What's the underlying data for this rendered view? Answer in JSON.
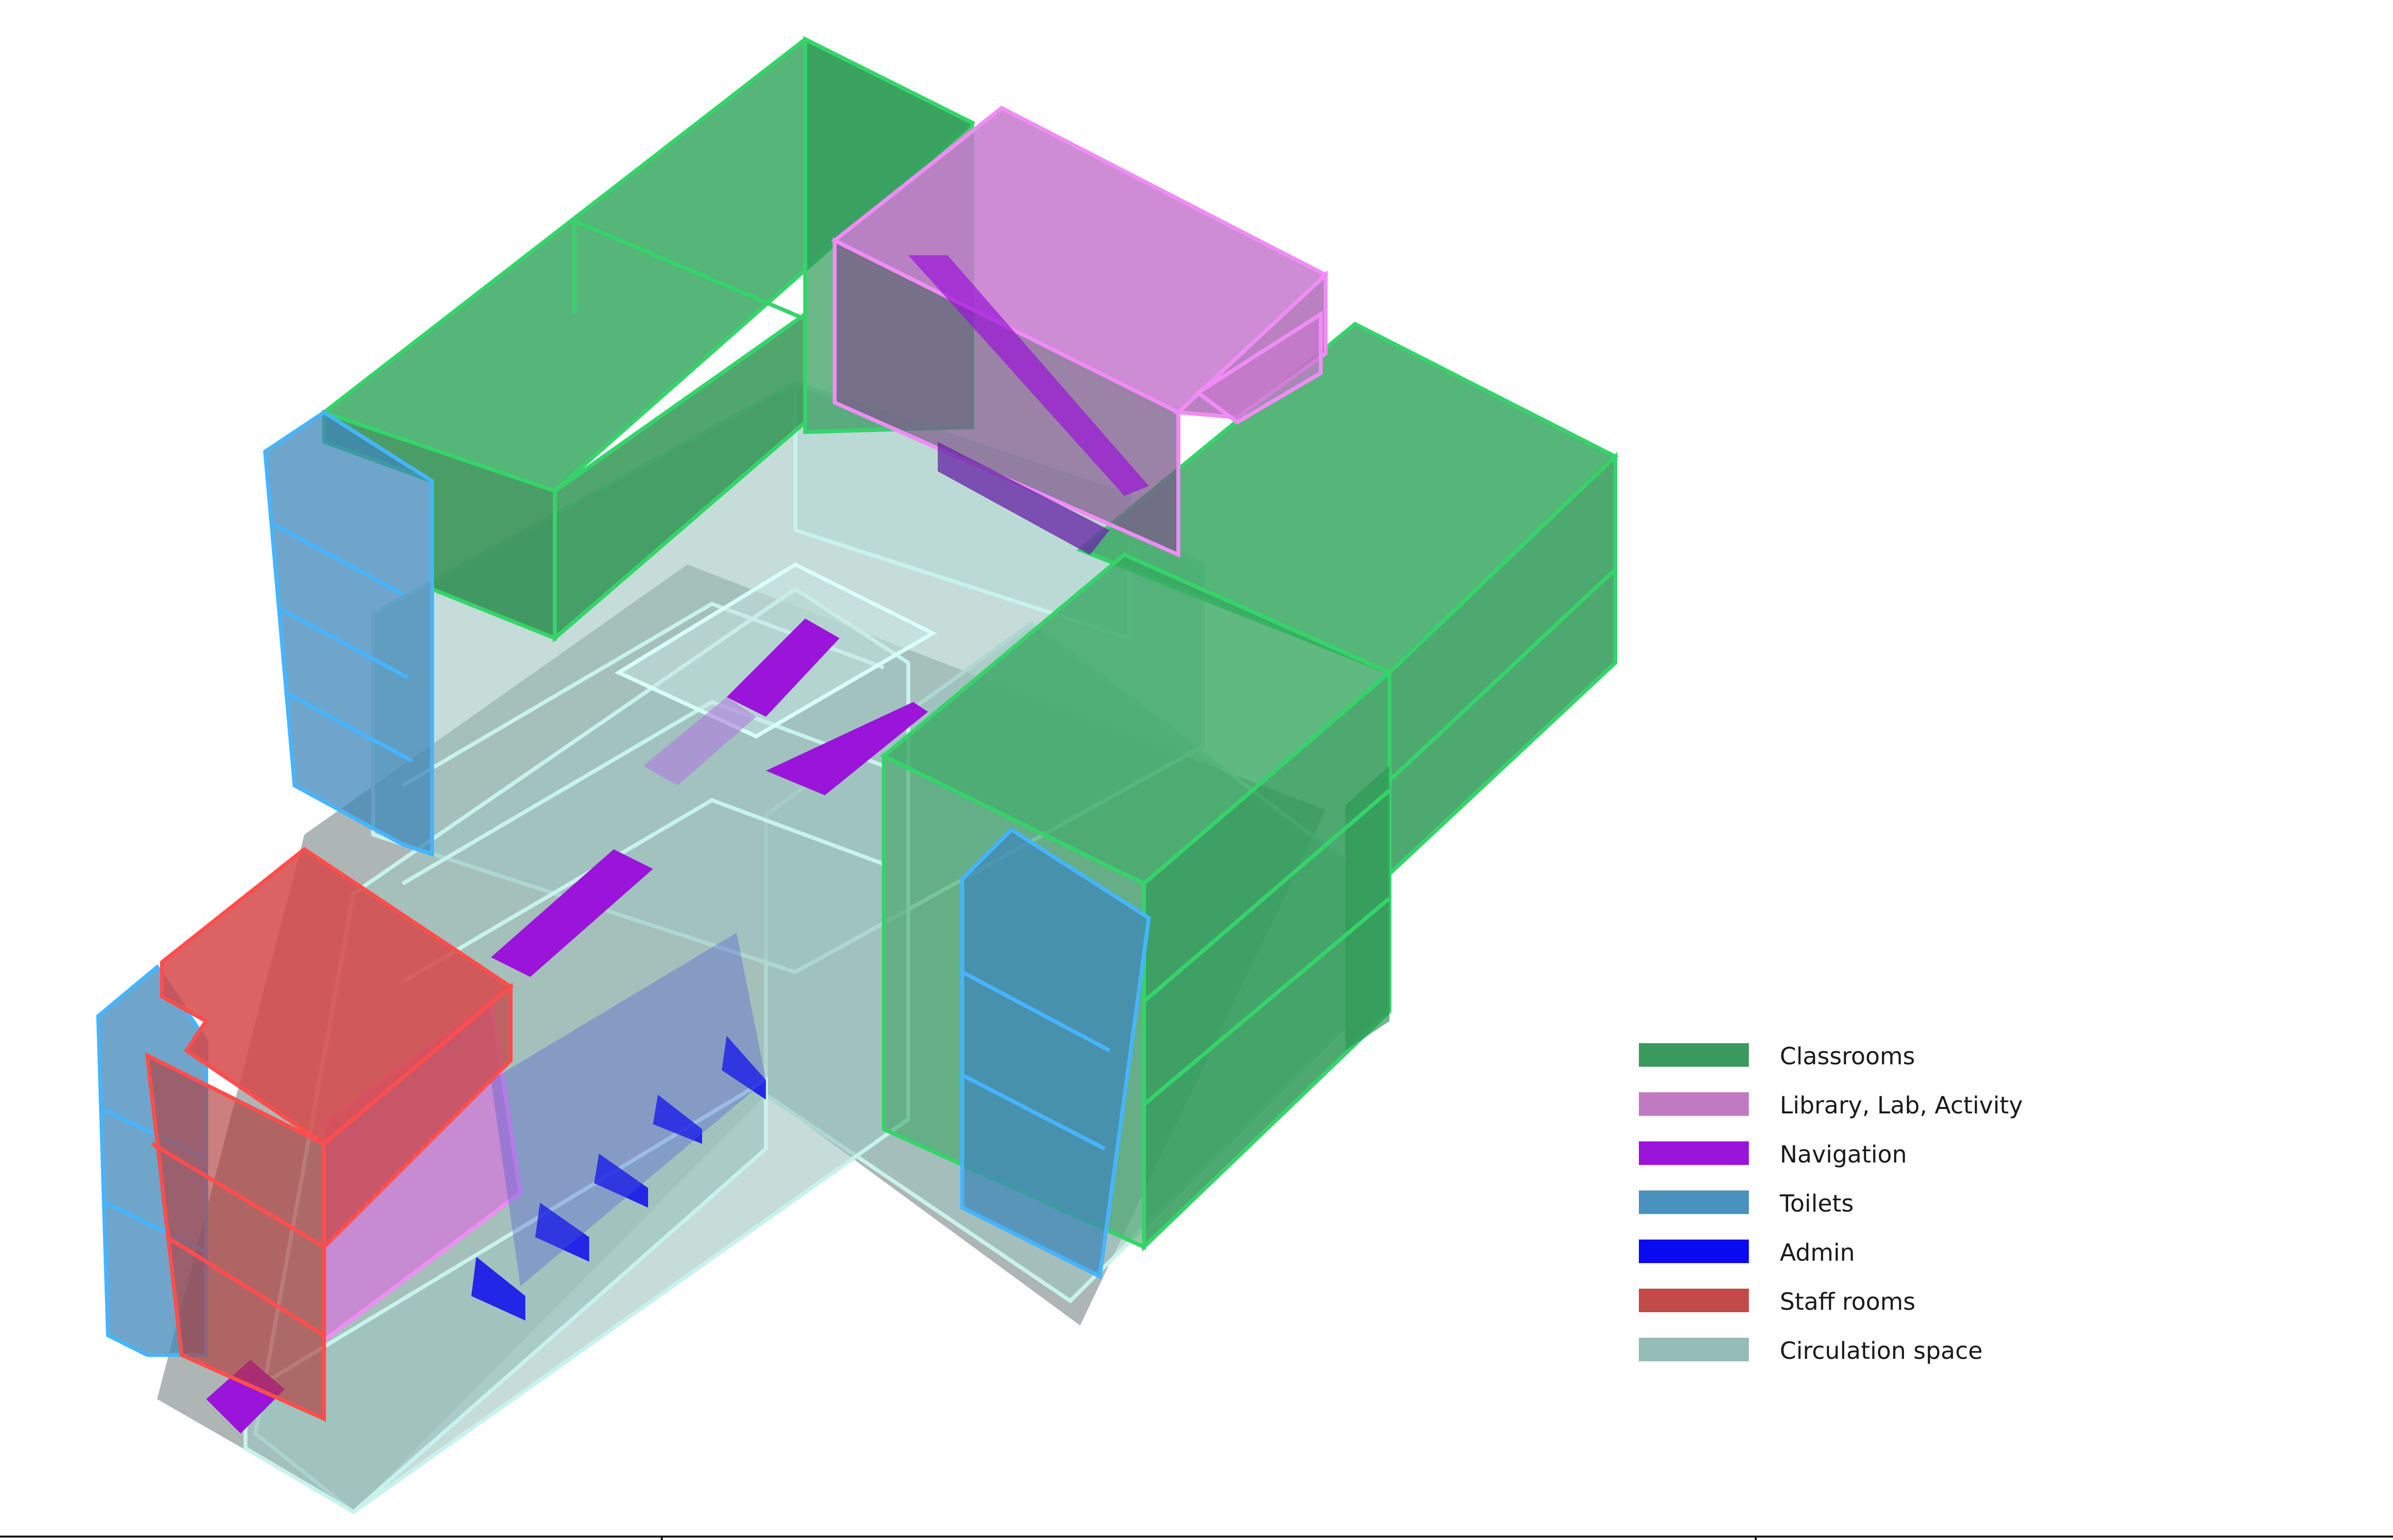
{
  "legend": {
    "items": [
      {
        "label": "Classrooms",
        "color": "#3a9a5e"
      },
      {
        "label": "Library, Lab, Activity",
        "color": "#c07ac2"
      },
      {
        "label": "Navigation",
        "color": "#9b14d9"
      },
      {
        "label": "Toilets",
        "color": "#4a92be"
      },
      {
        "label": "Admin",
        "color": "#0a0aee"
      },
      {
        "label": "Staff rooms",
        "color": "#c24a49"
      },
      {
        "label": "Circulation space",
        "color": "#93bdb6"
      }
    ]
  },
  "colors": {
    "classroom_fill": "#2e9e56",
    "classroom_edge": "#35d46a",
    "library_fill": "#d27ad8",
    "library_edge": "#f08cf5",
    "navigation": "#9b14d9",
    "toilet_fill": "#3f87b8",
    "toilet_edge": "#46b4ff",
    "admin": "#0a0aee",
    "staff_fill": "#d64848",
    "staff_edge": "#ff4d4d",
    "circulation_fill": "#9ec5bf",
    "circulation_edge": "#c8f2ec",
    "base": "#6b7a78"
  }
}
